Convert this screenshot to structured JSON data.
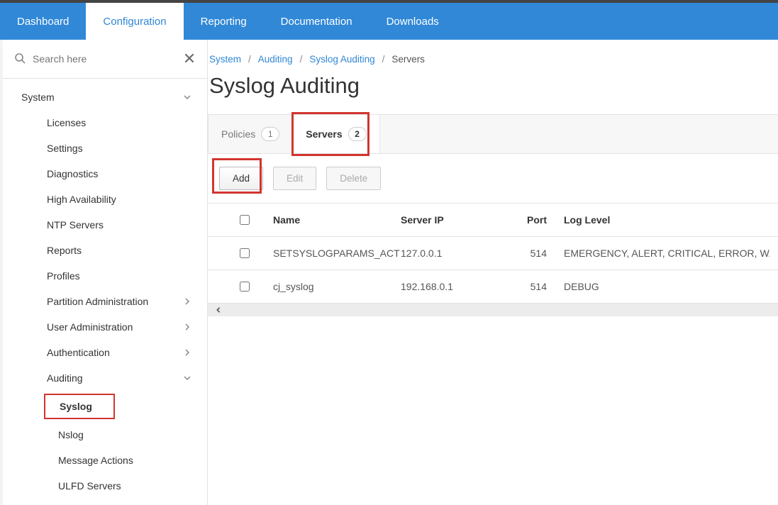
{
  "topnav": {
    "items": [
      "Dashboard",
      "Configuration",
      "Reporting",
      "Documentation",
      "Downloads"
    ],
    "active_index": 1
  },
  "search": {
    "placeholder": "Search here"
  },
  "sidebar": {
    "root": "System",
    "system_items": [
      "Licenses",
      "Settings",
      "Diagnostics",
      "High Availability",
      "NTP Servers",
      "Reports",
      "Profiles"
    ],
    "expandable_items": [
      "Partition Administration",
      "User Administration",
      "Authentication"
    ],
    "auditing": {
      "label": "Auditing",
      "children": [
        "Syslog",
        "Nslog",
        "Message Actions",
        "ULFD Servers"
      ],
      "active_child": "Syslog"
    }
  },
  "breadcrumb": {
    "links": [
      "System",
      "Auditing",
      "Syslog Auditing"
    ],
    "current": "Servers"
  },
  "title": "Syslog Auditing",
  "tabs": [
    {
      "label": "Policies",
      "count": 1
    },
    {
      "label": "Servers",
      "count": 2
    }
  ],
  "tab_active_index": 1,
  "actions": {
    "add": "Add",
    "edit": "Edit",
    "delete": "Delete"
  },
  "table": {
    "headers": [
      "Name",
      "Server IP",
      "Port",
      "Log Level"
    ],
    "rows": [
      {
        "name": "SETSYSLOGPARAMS_ACT",
        "ip": "127.0.0.1",
        "port": 514,
        "log": "EMERGENCY, ALERT, CRITICAL, ERROR, WARNIN"
      },
      {
        "name": "cj_syslog",
        "ip": "192.168.0.1",
        "port": 514,
        "log": "DEBUG"
      }
    ]
  }
}
